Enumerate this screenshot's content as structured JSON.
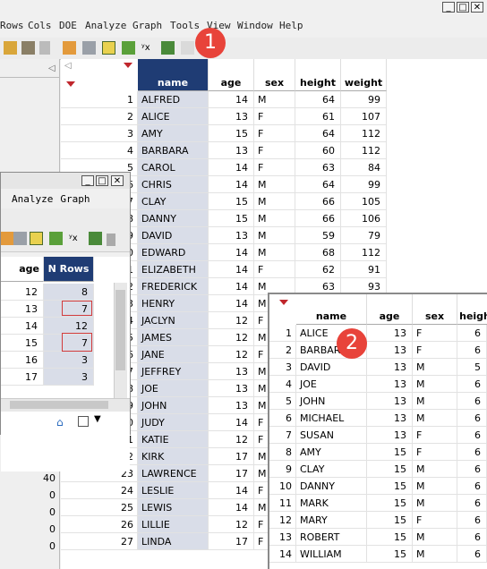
{
  "menu": [
    "Rows",
    "Cols",
    "DOE",
    "Analyze",
    "Graph",
    "Tools",
    "View",
    "Window",
    "Help"
  ],
  "badges": [
    "1",
    "2"
  ],
  "main_table": {
    "columns": [
      "name",
      "age",
      "sex",
      "height",
      "weight"
    ],
    "rows": [
      [
        "1",
        "ALFRED",
        "14",
        "M",
        "64",
        "99"
      ],
      [
        "2",
        "ALICE",
        "13",
        "F",
        "61",
        "107"
      ],
      [
        "3",
        "AMY",
        "15",
        "F",
        "64",
        "112"
      ],
      [
        "4",
        "BARBARA",
        "13",
        "F",
        "60",
        "112"
      ],
      [
        "5",
        "CAROL",
        "14",
        "F",
        "63",
        "84"
      ],
      [
        "6",
        "CHRIS",
        "14",
        "M",
        "64",
        "99"
      ],
      [
        "7",
        "CLAY",
        "15",
        "M",
        "66",
        "105"
      ],
      [
        "8",
        "DANNY",
        "15",
        "M",
        "66",
        "106"
      ],
      [
        "9",
        "DAVID",
        "13",
        "M",
        "59",
        "79"
      ],
      [
        "10",
        "EDWARD",
        "14",
        "M",
        "68",
        "112"
      ],
      [
        "11",
        "ELIZABETH",
        "14",
        "F",
        "62",
        "91"
      ],
      [
        "12",
        "FREDERICK",
        "14",
        "M",
        "63",
        "93"
      ],
      [
        "13",
        "HENRY",
        "14",
        "M",
        "",
        ""
      ],
      [
        "14",
        "JACLYN",
        "12",
        "F",
        "",
        ""
      ],
      [
        "15",
        "JAMES",
        "12",
        "M",
        "",
        ""
      ],
      [
        "16",
        "JANE",
        "12",
        "F",
        "",
        ""
      ],
      [
        "17",
        "JEFFREY",
        "13",
        "M",
        "",
        ""
      ],
      [
        "18",
        "JOE",
        "13",
        "M",
        "",
        ""
      ],
      [
        "19",
        "JOHN",
        "13",
        "M",
        "",
        ""
      ],
      [
        "20",
        "JUDY",
        "14",
        "F",
        "",
        ""
      ],
      [
        "21",
        "KATIE",
        "12",
        "F",
        "",
        ""
      ],
      [
        "22",
        "KIRK",
        "17",
        "M",
        "",
        ""
      ],
      [
        "23",
        "LAWRENCE",
        "17",
        "M",
        "",
        ""
      ],
      [
        "24",
        "LESLIE",
        "14",
        "F",
        "",
        ""
      ],
      [
        "25",
        "LEWIS",
        "14",
        "M",
        "",
        ""
      ],
      [
        "26",
        "LILLIE",
        "12",
        "F",
        "",
        ""
      ],
      [
        "27",
        "LINDA",
        "17",
        "F",
        "",
        ""
      ]
    ]
  },
  "summary_window": {
    "menu": [
      "Analyze",
      "Graph"
    ],
    "columns": [
      "age",
      "N Rows"
    ],
    "rows": [
      [
        "12",
        "8"
      ],
      [
        "13",
        "7"
      ],
      [
        "14",
        "12"
      ],
      [
        "15",
        "7"
      ],
      [
        "16",
        "3"
      ],
      [
        "17",
        "3"
      ]
    ]
  },
  "left_panel_values": [
    "40",
    "0",
    "0",
    "0",
    "0"
  ],
  "subset_table": {
    "columns": [
      "name",
      "age",
      "sex",
      "heigh"
    ],
    "rows": [
      [
        "1",
        "ALICE",
        "13",
        "F",
        "6"
      ],
      [
        "2",
        "BARBARA",
        "13",
        "F",
        "6"
      ],
      [
        "3",
        "DAVID",
        "13",
        "M",
        "5"
      ],
      [
        "4",
        "JOE",
        "13",
        "M",
        "6"
      ],
      [
        "5",
        "JOHN",
        "13",
        "M",
        "6"
      ],
      [
        "6",
        "MICHAEL",
        "13",
        "M",
        "6"
      ],
      [
        "7",
        "SUSAN",
        "13",
        "F",
        "6"
      ],
      [
        "8",
        "AMY",
        "15",
        "F",
        "6"
      ],
      [
        "9",
        "CLAY",
        "15",
        "M",
        "6"
      ],
      [
        "10",
        "DANNY",
        "15",
        "M",
        "6"
      ],
      [
        "11",
        "MARK",
        "15",
        "M",
        "6"
      ],
      [
        "12",
        "MARY",
        "15",
        "F",
        "6"
      ],
      [
        "13",
        "ROBERT",
        "15",
        "M",
        "6"
      ],
      [
        "14",
        "WILLIAM",
        "15",
        "M",
        "6"
      ]
    ]
  },
  "colors": {
    "accent": "#1f3c74",
    "badge": "#e8433a",
    "highlight": "#d23b3b"
  }
}
